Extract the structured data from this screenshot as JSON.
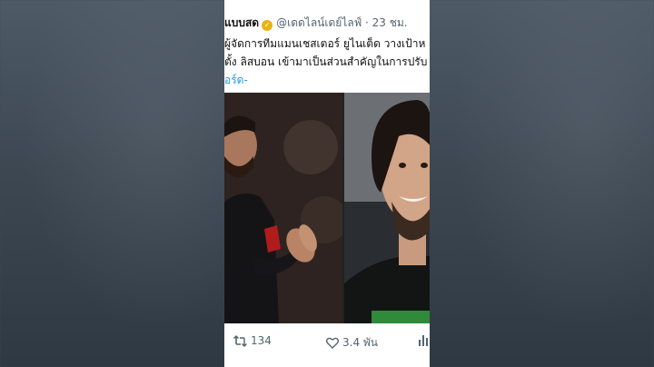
{
  "tweet": {
    "display_name": "แบบสด",
    "handle": "@เดดไลน์เดย์ไลฟ์",
    "separator": "·",
    "time": "23 ชม.",
    "text_line1": "ผู้จัดการทีมแมนเชสเตอร์ ยูไนเต็ด วางเป้าห",
    "text_line2": "ตั้ง ลิสบอน เข้ามาเป็นส่วนสำคัญในการปรับ",
    "text_line3": "อร์ด-"
  },
  "actions": {
    "retweet_count": "134",
    "like_count": "3.4 พัน"
  },
  "colors": {
    "link": "#1d9bf0",
    "verified_badge": "#e9b215",
    "meta_text": "#536471"
  },
  "icons": {
    "verified": "verified-badge-icon",
    "retweet": "retweet-icon",
    "like": "heart-icon",
    "views": "bar-chart-icon"
  }
}
